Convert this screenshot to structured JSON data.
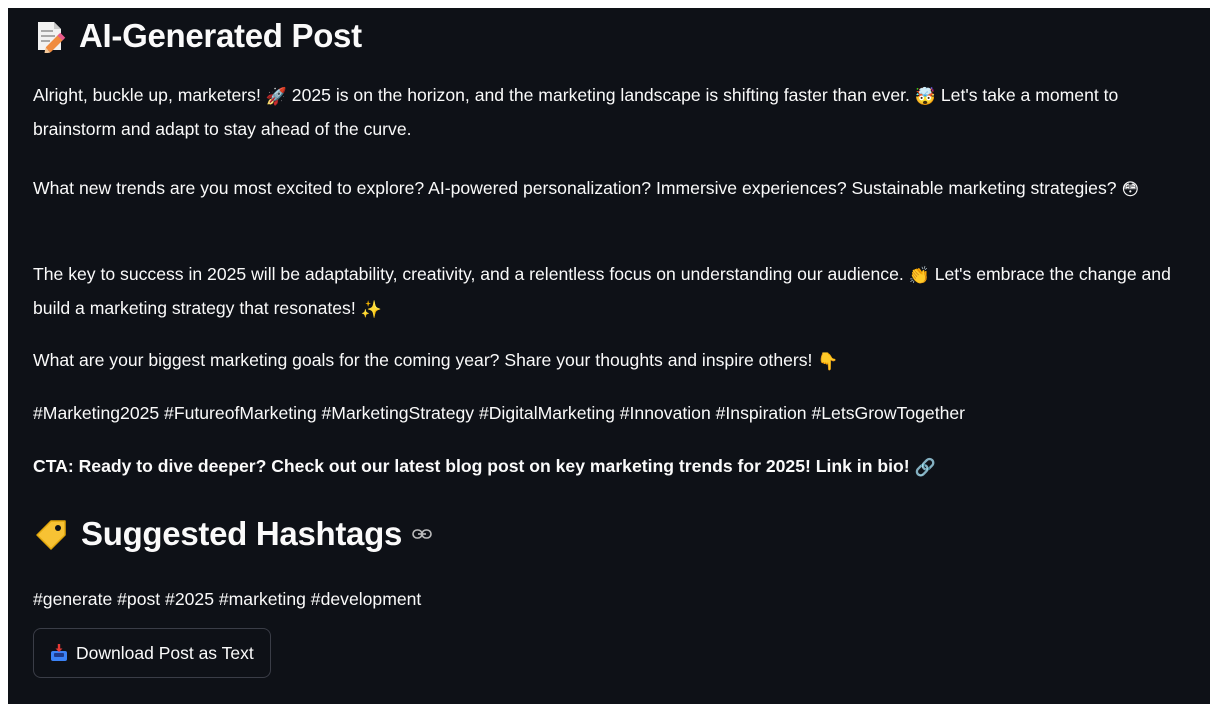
{
  "post": {
    "title": "AI-Generated Post",
    "title_icon": "memo-pencil-icon",
    "paragraphs": [
      {
        "segments": [
          {
            "text": "Alright, buckle up, marketers! "
          },
          {
            "emoji": "🚀",
            "icon": "rocket-icon"
          },
          {
            "text": " 2025 is on the horizon, and the marketing landscape is shifting faster than ever. "
          },
          {
            "emoji": "🤯",
            "icon": "exploding-head-icon"
          },
          {
            "text": " Let's take a moment to brainstorm and adapt to stay ahead of the curve."
          }
        ]
      },
      {
        "segments": [
          {
            "text": "What new trends are you most excited to explore? AI-powered personalization? Immersive experiences? Sustainable marketing strategies? "
          },
          {
            "emoji": "😳",
            "icon": "flushed-face-icon"
          }
        ]
      },
      {
        "segments": [
          {
            "text": "The key to success in 2025 will be adaptability, creativity, and a relentless focus on understanding our audience. "
          },
          {
            "emoji": "👏",
            "icon": "clapping-hands-icon"
          },
          {
            "text": " Let's embrace the change and build a marketing strategy that resonates! "
          },
          {
            "emoji": "✨",
            "icon": "sparkles-icon"
          }
        ]
      },
      {
        "segments": [
          {
            "text": "What are your biggest marketing goals for the coming year? Share your thoughts and inspire others! "
          },
          {
            "emoji": "👇",
            "icon": "pointing-down-icon"
          }
        ]
      },
      {
        "segments": [
          {
            "text": "#Marketing2025 #FutureofMarketing #MarketingStrategy #DigitalMarketing #Innovation #Inspiration #LetsGrowTogether"
          }
        ]
      },
      {
        "bold": true,
        "segments": [
          {
            "text": "CTA: Ready to dive deeper? Check out our latest blog post on key marketing trends for 2025! Link in bio! "
          },
          {
            "emoji": "🔗",
            "icon": "link-icon"
          }
        ]
      }
    ]
  },
  "hashtags_section": {
    "title": "Suggested Hashtags",
    "title_icon": "tag-label-icon",
    "anchor_icon": "anchor-link-icon",
    "hashtags": "#generate #post #2025 #marketing #development"
  },
  "download_button": {
    "label": "Download Post as Text",
    "icon": "inbox-tray-icon"
  },
  "colors": {
    "background": "#0e1117",
    "text": "#fafafa",
    "button_border": "#3a3d47"
  }
}
